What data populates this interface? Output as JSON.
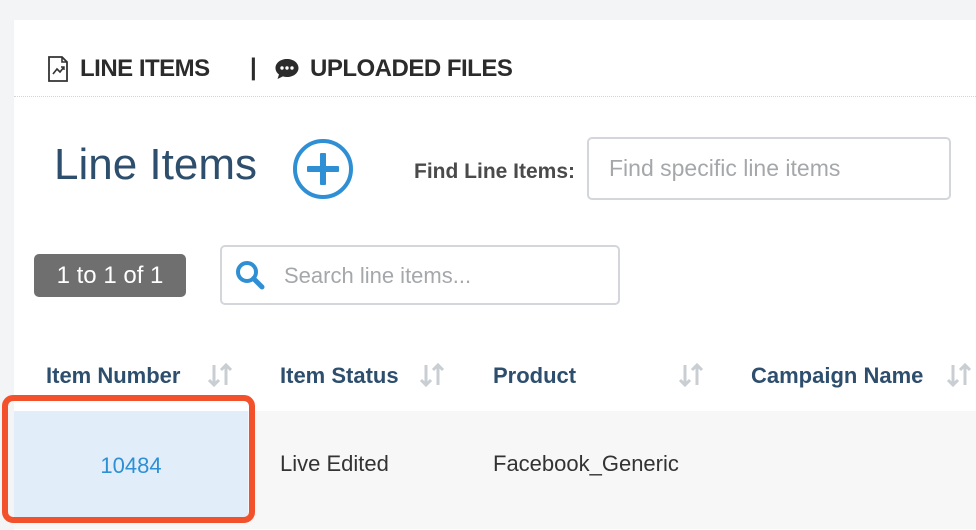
{
  "tabs": {
    "line_items": "LINE ITEMS",
    "separator": "|",
    "uploaded_files": "UPLOADED FILES"
  },
  "page": {
    "title": "Line Items",
    "find_label": "Find Line Items:",
    "find_placeholder": "Find specific line items"
  },
  "list": {
    "count": "1 to 1 of 1",
    "search_placeholder": "Search line items..."
  },
  "table": {
    "columns": [
      "Item Number",
      "Item Status",
      "Product",
      "Campaign Name"
    ],
    "rows": [
      {
        "item_number": "10484",
        "item_status": "Live Edited",
        "product": "Facebook_Generic",
        "campaign_name": ""
      }
    ]
  },
  "colors": {
    "accent": "#2f8fd5",
    "heading": "#2d4e6d",
    "highlight": "#f2512c"
  },
  "icons": {
    "line_items_tab": "chart-document-icon",
    "uploaded_files_tab": "speech-bubble-icon",
    "add": "plus-circle-icon",
    "search": "search-icon",
    "sort": "sort-arrows-icon"
  }
}
